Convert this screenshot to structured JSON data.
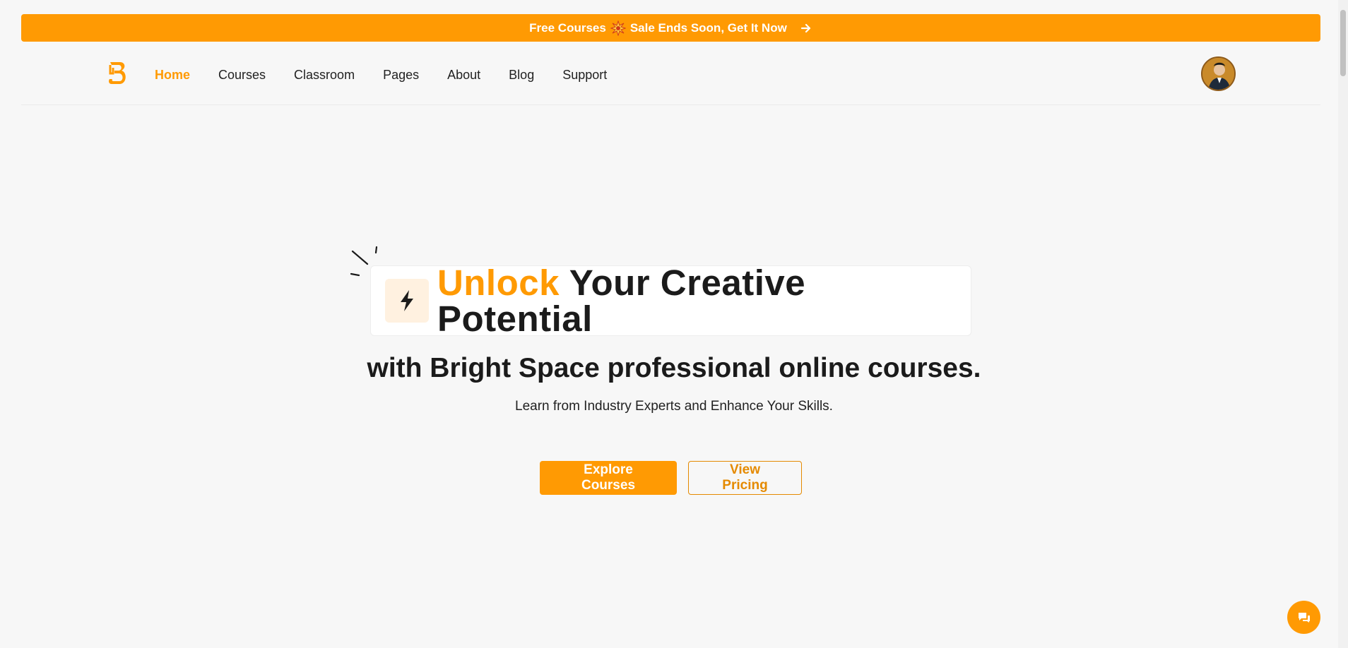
{
  "promo": {
    "text_before": "Free Courses",
    "text_after": "Sale Ends Soon, Get It Now",
    "star_icon": "sparkle-burst-icon",
    "arrow_icon": "arrow-right-icon"
  },
  "nav": {
    "logo_icon": "brightspace-logo",
    "items": [
      {
        "label": "Home",
        "active": true
      },
      {
        "label": "Courses",
        "active": false
      },
      {
        "label": "Classroom",
        "active": false
      },
      {
        "label": "Pages",
        "active": false
      },
      {
        "label": "About",
        "active": false
      },
      {
        "label": "Blog",
        "active": false
      },
      {
        "label": "Support",
        "active": false
      }
    ],
    "avatar_icon": "user-avatar"
  },
  "hero": {
    "title_accent": "Unlock",
    "title_rest": "Your Creative Potential",
    "subtitle": "with Bright Space professional online courses.",
    "description": "Learn from Industry Experts and Enhance Your Skills.",
    "primary_button": "Explore Courses",
    "secondary_button": "View Pricing",
    "bolt_icon": "lightning-bolt-icon"
  },
  "chat": {
    "icon": "chat-bubble-icon"
  },
  "colors": {
    "accent": "#ff9a03",
    "background": "#f7f7f7",
    "text": "#1b1b1b"
  }
}
